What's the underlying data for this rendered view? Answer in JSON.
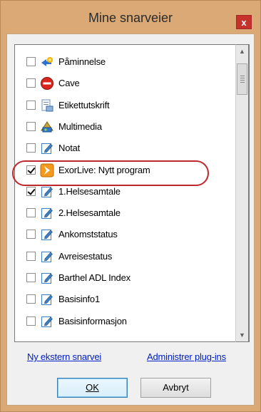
{
  "window": {
    "title": "Mine snarveier",
    "close_label": "x"
  },
  "shortcuts": [
    {
      "label": "Påminnelse",
      "checked": false,
      "icon": "reminder-icon"
    },
    {
      "label": "Cave",
      "checked": false,
      "icon": "stop-icon"
    },
    {
      "label": "Etikettutskrift",
      "checked": false,
      "icon": "label-print-icon"
    },
    {
      "label": "Multimedia",
      "checked": false,
      "icon": "multimedia-icon"
    },
    {
      "label": "Notat",
      "checked": false,
      "icon": "note-icon"
    },
    {
      "label": "ExorLive: Nytt program",
      "checked": true,
      "icon": "exorlive-icon"
    },
    {
      "label": "1.Helsesamtale",
      "checked": true,
      "icon": "note-icon"
    },
    {
      "label": "2.Helsesamtale",
      "checked": false,
      "icon": "note-icon"
    },
    {
      "label": "Ankomststatus",
      "checked": false,
      "icon": "note-icon"
    },
    {
      "label": "Avreisestatus",
      "checked": false,
      "icon": "note-icon"
    },
    {
      "label": "Barthel ADL Index",
      "checked": false,
      "icon": "note-icon"
    },
    {
      "label": "Basisinfo1",
      "checked": false,
      "icon": "note-icon"
    },
    {
      "label": "Basisinformasjon",
      "checked": false,
      "icon": "note-icon"
    }
  ],
  "links": {
    "new_external": "Ny ekstern snarvei",
    "manage_plugins": "Administrer plug-ins"
  },
  "buttons": {
    "ok": "OK",
    "cancel": "Avbryt"
  },
  "colors": {
    "frame": "#dba975",
    "close": "#c7312c",
    "highlight": "#c0272d",
    "link": "#0020c8"
  }
}
